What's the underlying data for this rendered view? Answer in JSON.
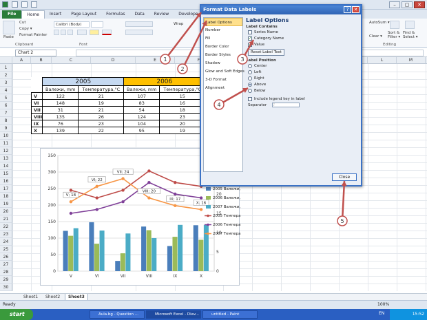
{
  "tabs": [
    "File",
    "Home",
    "Insert",
    "Page Layout",
    "Formulas",
    "Data",
    "Review",
    "Develope"
  ],
  "ribbon": {
    "paste": "Paste",
    "cut": "Cut",
    "copy": "Copy ▾",
    "format_painter": "Format Painter",
    "clipboard": "Clipboard",
    "font_name": "Calibri (Body)",
    "font_label": "Font",
    "wrap": "Wrap",
    "autosum": "AutoSum ▾",
    "clear": "Clear ▾",
    "sort": "Sort &\nFilter ▾",
    "find": "Find &\nSelect ▾",
    "editing": "Editing"
  },
  "namebox": "Chart 2",
  "columns": [
    "A",
    "B",
    "C",
    "D",
    "E",
    "F",
    "G",
    "H",
    "I",
    "J",
    "K",
    "L",
    "M",
    "N",
    "O"
  ],
  "rows": [
    "1",
    "2",
    "3",
    "4",
    "5",
    "6",
    "7",
    "8",
    "9",
    "10",
    "11",
    "12",
    "13",
    "14",
    "15",
    "16",
    "17",
    "18",
    "19",
    "20",
    "21",
    "22",
    "23",
    "24",
    "25",
    "26",
    "27",
    "28",
    "29",
    "30",
    "31",
    "32",
    "33",
    "34"
  ],
  "table": {
    "years": [
      "2005",
      "2006"
    ],
    "headers": [
      "Валежи, mm",
      "Температура,°C",
      "Валежи, mm",
      "Температура,°C"
    ],
    "rows": [
      {
        "m": "V",
        "a": "122",
        "b": "21",
        "c": "107",
        "d": "15"
      },
      {
        "m": "VI",
        "a": "148",
        "b": "19",
        "c": "83",
        "d": "16"
      },
      {
        "m": "VII",
        "a": "31",
        "b": "21",
        "c": "54",
        "d": "18"
      },
      {
        "m": "VIII",
        "a": "135",
        "b": "26",
        "c": "124",
        "d": "23"
      },
      {
        "m": "IX",
        "a": "76",
        "b": "23",
        "c": "104",
        "d": "20"
      },
      {
        "m": "X",
        "a": "139",
        "b": "22",
        "c": "95",
        "d": "19"
      }
    ]
  },
  "chart_data": {
    "type": "bar",
    "categories": [
      "V",
      "VI",
      "VII",
      "VIII",
      "IX",
      "X"
    ],
    "ylim": [
      0,
      350
    ],
    "y_ticks": [
      "0",
      "50",
      "100",
      "150",
      "200",
      "250",
      "300",
      "350"
    ],
    "y2lim": [
      0,
      30
    ],
    "y2_ticks": [
      "0",
      "5",
      "10",
      "15",
      "20",
      "25",
      "30"
    ],
    "bar_series": [
      {
        "name": "2005 Валежи, mm",
        "color": "#4a7ebb",
        "values": [
          122,
          148,
          31,
          135,
          76,
          139
        ]
      },
      {
        "name": "2006 Валежи, mm",
        "color": "#9bbb59",
        "values": [
          107,
          83,
          54,
          124,
          104,
          95
        ]
      },
      {
        "name": "2007 Валежи, mm",
        "color": "#4bacc6",
        "values": [
          130,
          123,
          114,
          100,
          140,
          140
        ]
      }
    ],
    "line_series": [
      {
        "name": "2005 Температура,°C",
        "color": "#be4b48",
        "values": [
          21,
          19,
          21,
          26,
          23,
          22
        ]
      },
      {
        "name": "2006 Температура,°C",
        "color": "#7f3f98",
        "values": [
          15,
          16,
          18,
          23,
          20,
          19
        ]
      },
      {
        "name": "2007 Температура,°C",
        "color": "#f79646",
        "values": [
          18,
          22,
          24,
          19,
          17,
          16
        ]
      }
    ],
    "data_labels": [
      "V; 18",
      "VI; 22",
      "VII; 24",
      "VIII; 20",
      "IX; 17",
      "X; 16"
    ],
    "legend": "right"
  },
  "dialog": {
    "title": "Format Data Labels",
    "nav": [
      "Label Options",
      "Number",
      "Fill",
      "Border Color",
      "Border Styles",
      "Shadow",
      "Glow and Soft Edges",
      "3-D Format",
      "Alignment"
    ],
    "heading": "Label Options",
    "contains": "Label Contains",
    "opts": [
      "Series Name",
      "Category Name",
      "Value"
    ],
    "opt_checked": [
      false,
      true,
      true
    ],
    "reset": "Reset Label Text",
    "position": "Label Position",
    "positions": [
      "Center",
      "Left",
      "Right",
      "Above",
      "Below"
    ],
    "selected_position": "Above",
    "legend_key": "Include legend key in label",
    "separator": "Separator",
    "separator_value": ";",
    "close": "Close"
  },
  "callouts": [
    "1",
    "2",
    "3",
    "4",
    "5"
  ],
  "sheets": [
    "Sheet1",
    "Sheet2",
    "Sheet3"
  ],
  "status": {
    "ready": "Ready",
    "zoom": "100%"
  },
  "taskbar": {
    "start": "start",
    "items": [
      "Aula.bg - Question ...",
      "Microsoft Excel - Diav...",
      "untitled - Paint"
    ],
    "lang": "EN",
    "time": "15:52"
  }
}
